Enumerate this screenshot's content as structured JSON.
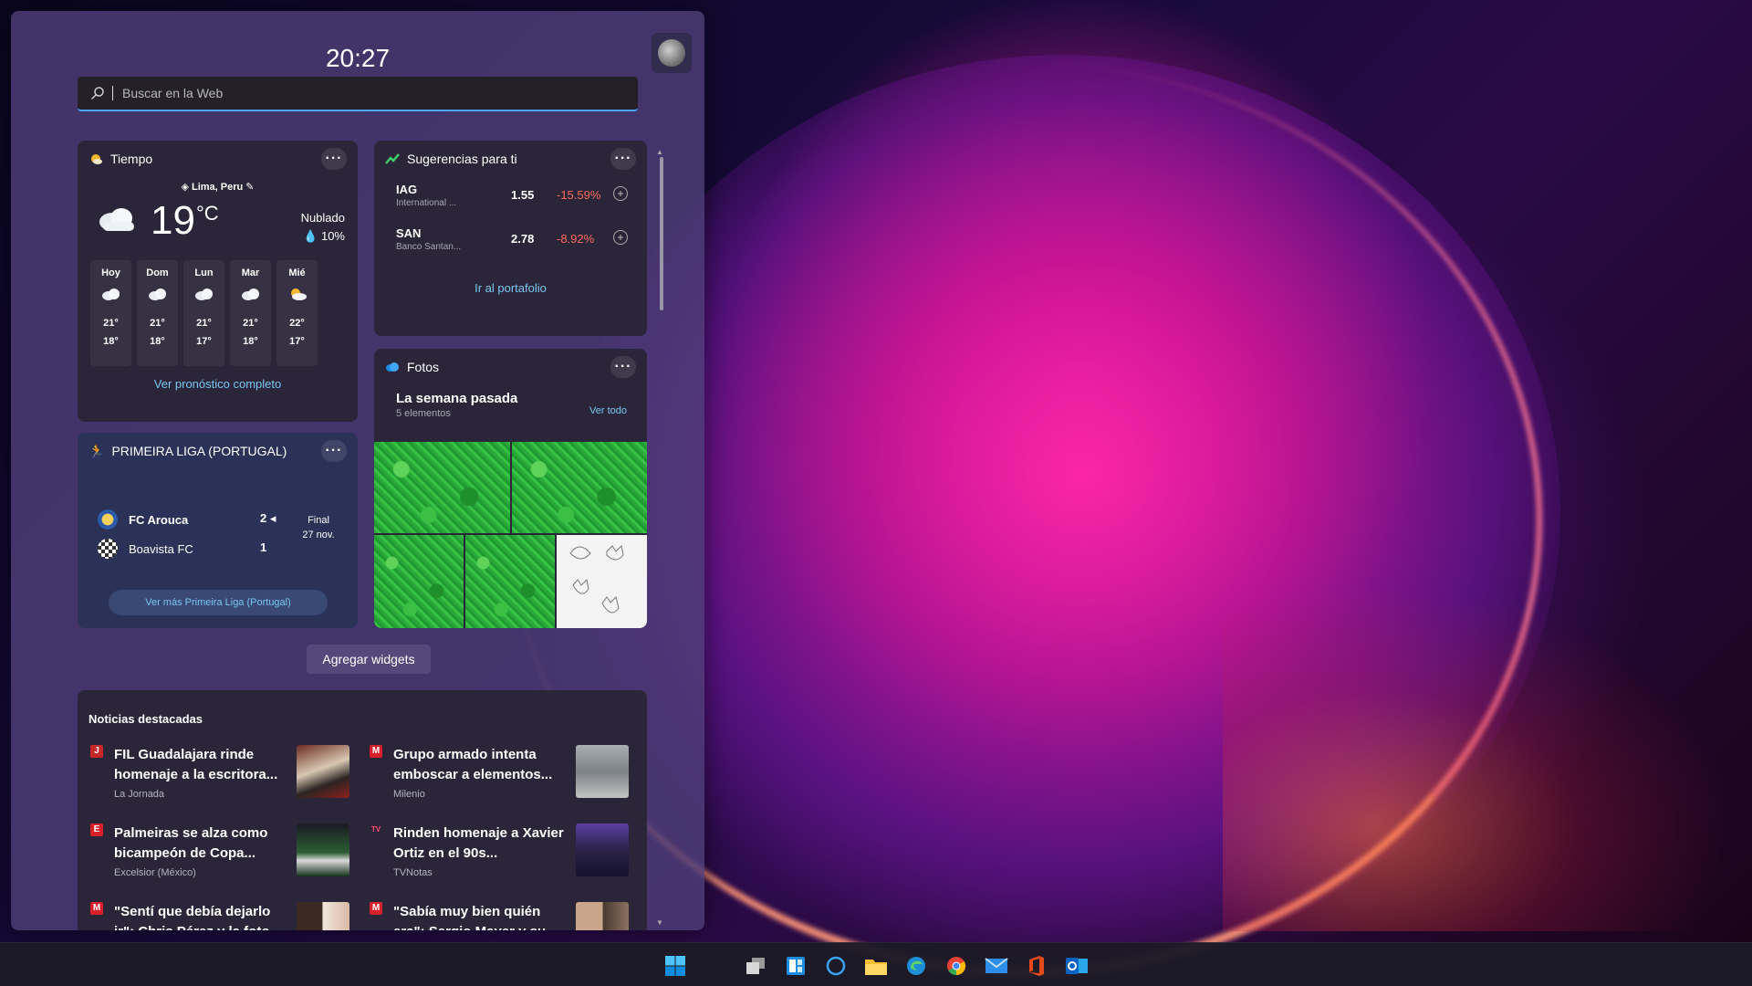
{
  "clock": "20:27",
  "search": {
    "placeholder": "Buscar en la Web"
  },
  "weather": {
    "title": "Tiempo",
    "location": "Lima, Peru",
    "temp": "19",
    "unit": "°C",
    "condition": "Nublado",
    "precip": "10%",
    "days": [
      {
        "name": "Hoy",
        "hi": "21°",
        "lo": "18°",
        "icon": "cloud-icon"
      },
      {
        "name": "Dom",
        "hi": "21°",
        "lo": "18°",
        "icon": "cloud-icon"
      },
      {
        "name": "Lun",
        "hi": "21°",
        "lo": "17°",
        "icon": "cloud-icon"
      },
      {
        "name": "Mar",
        "hi": "21°",
        "lo": "18°",
        "icon": "cloud-icon"
      },
      {
        "name": "Mié",
        "hi": "22°",
        "lo": "17°",
        "icon": "partly-sunny-icon"
      }
    ],
    "forecast_link": "Ver pronóstico completo"
  },
  "stocks": {
    "title": "Sugerencias para ti",
    "items": [
      {
        "symbol": "IAG",
        "name": "International ...",
        "price": "1.55",
        "change": "-15.59%"
      },
      {
        "symbol": "SAN",
        "name": "Banco Santan...",
        "price": "2.78",
        "change": "-8.92%"
      }
    ],
    "portfolio_link": "Ir al portafolio"
  },
  "photos": {
    "title": "Fotos",
    "subtitle": "La semana pasada",
    "count": "5 elementos",
    "see_all": "Ver todo"
  },
  "football": {
    "title": "PRIMEIRA LIGA (PORTUGAL)",
    "home": {
      "name": "FC Arouca",
      "score": "2"
    },
    "away": {
      "name": "Boavista FC",
      "score": "1"
    },
    "status": "Final",
    "date": "27 nov.",
    "more_link": "Ver más Primeira Liga (Portugal)"
  },
  "add_widgets": "Agregar widgets",
  "news": {
    "heading": "Noticias destacadas",
    "items": [
      {
        "title": "FIL Guadalajara rinde homenaje a la escritora...",
        "source": "La Jornada",
        "icon": "J"
      },
      {
        "title": "Grupo armado intenta emboscar a elementos...",
        "source": "Milenio",
        "icon": "M"
      },
      {
        "title": "Palmeiras se alza como bicampeón de Copa...",
        "source": "Excelsior (México)",
        "icon": "E"
      },
      {
        "title": "Rinden homenaje a Xavier Ortiz en el 90s...",
        "source": "TVNotas",
        "icon": "TV"
      },
      {
        "title": "\"Sentí que debía dejarlo ir\": Chris Pérez y la foto...",
        "source": "",
        "icon": "M"
      },
      {
        "title": "\"Sabía muy bien quién era\": Sergio Mayer y su...",
        "source": "",
        "icon": "M"
      }
    ]
  },
  "colors": {
    "accent": "#4aa6ff",
    "link": "#7cc6f2",
    "negative": "#ff6b5e"
  }
}
